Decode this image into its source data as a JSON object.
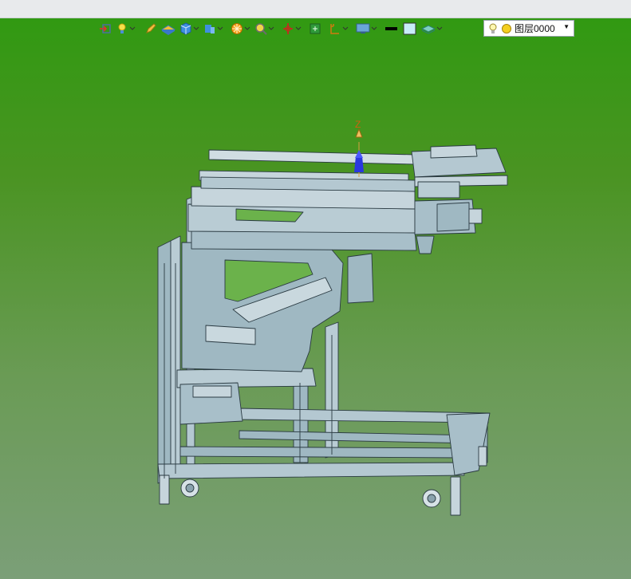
{
  "window": {
    "top_strip": ""
  },
  "toolbar": {
    "icons": [
      "view-reset-icon",
      "light-icon",
      "pencil-icon",
      "shade-icon",
      "cube-icon",
      "section-icon",
      "render-icon",
      "zoom-icon",
      "axis-icon",
      "fit-icon",
      "measure-icon",
      "display-icon",
      "color-black-icon",
      "color-lightblue-icon",
      "layer-shape-icon"
    ],
    "layer_combo": {
      "label": "图层0000"
    }
  },
  "viewport": {
    "axis_label": "Z",
    "background_colors": {
      "top": "#2e9a10",
      "bottom": "#7b9f78"
    },
    "model_color": "#9fb8c2"
  }
}
